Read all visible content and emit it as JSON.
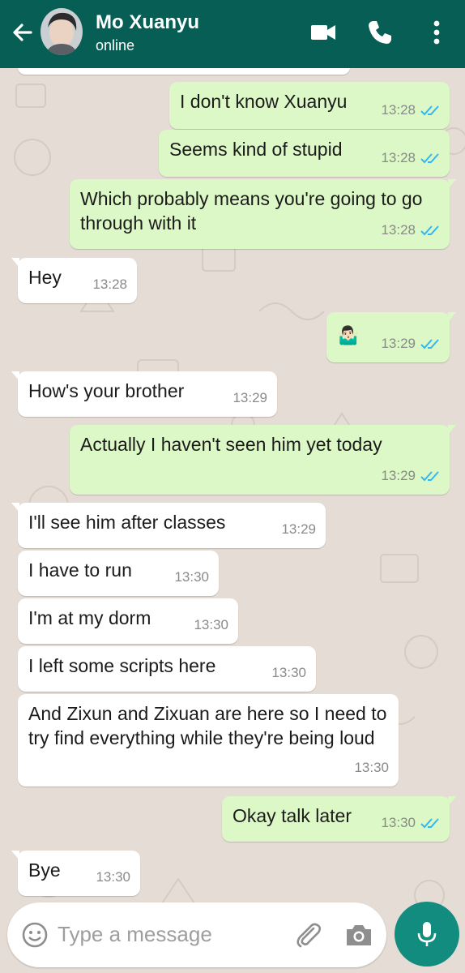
{
  "header": {
    "contact_name": "Mo Xuanyu",
    "status": "online",
    "icons": [
      "back-arrow-icon",
      "video-call-icon",
      "voice-call-icon",
      "more-options-icon"
    ]
  },
  "messages": [
    {
      "from": "me",
      "text": "I don't know Xuanyu",
      "time": "13:28",
      "ticks": "read"
    },
    {
      "from": "me",
      "text": "Seems kind of stupid",
      "time": "13:28",
      "ticks": "read"
    },
    {
      "from": "me",
      "text": "Which probably means you're going to go through with it",
      "time": "13:28",
      "ticks": "read"
    },
    {
      "from": "contact",
      "text": "Hey",
      "time": "13:28"
    },
    {
      "from": "me",
      "text": "🤷🏻‍♂️",
      "time": "13:29",
      "ticks": "read"
    },
    {
      "from": "contact",
      "text": "How's your brother",
      "time": "13:29"
    },
    {
      "from": "me",
      "text": "Actually I haven't seen him yet today",
      "time": "13:29",
      "ticks": "read"
    },
    {
      "from": "contact",
      "text": "I'll see him after classes",
      "time": "13:29"
    },
    {
      "from": "contact",
      "text": "I have to run",
      "time": "13:30"
    },
    {
      "from": "contact",
      "text": "I'm at my dorm",
      "time": "13:30"
    },
    {
      "from": "contact",
      "text": "I left some scripts here",
      "time": "13:30"
    },
    {
      "from": "contact",
      "text": "And Zixun and Zixuan are here so I need to try find everything while they're being loud",
      "time": "13:30"
    },
    {
      "from": "me",
      "text": "Okay talk later",
      "time": "13:30",
      "ticks": "read"
    },
    {
      "from": "contact",
      "text": "Bye",
      "time": "13:30"
    }
  ],
  "composer": {
    "placeholder": "Type a message",
    "icons": [
      "emoji-icon",
      "attach-icon",
      "camera-icon",
      "mic-icon"
    ]
  },
  "colors": {
    "header": "#075e54",
    "outgoing_bubble": "#dcf8c6",
    "incoming_bubble": "#ffffff",
    "chat_background": "#e5ddd5",
    "read_ticks": "#34b7f1",
    "mic_button": "#128c7e"
  }
}
